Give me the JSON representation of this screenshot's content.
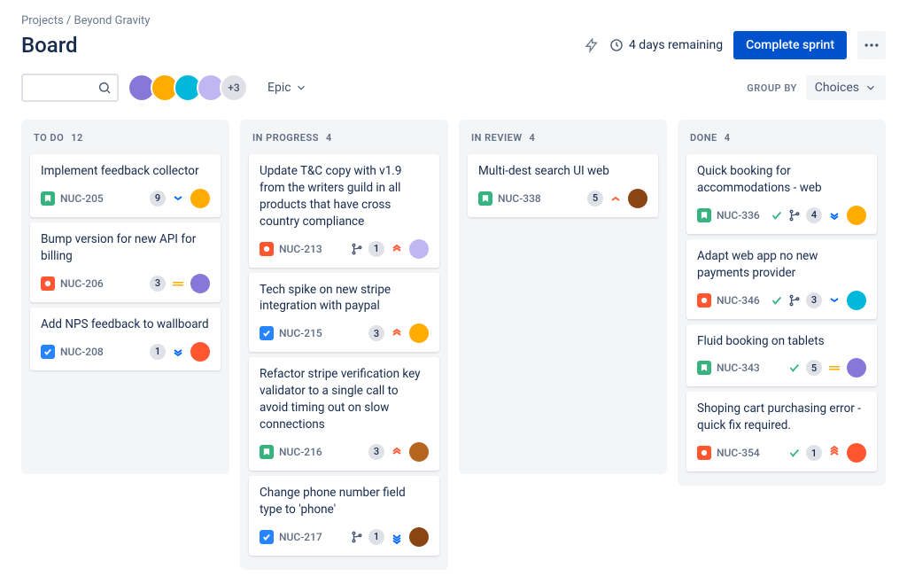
{
  "breadcrumb": {
    "root": "Projects",
    "project": "Beyond Gravity"
  },
  "page_title": "Board",
  "header": {
    "days_remaining": "4 days remaining",
    "complete_sprint": "Complete sprint"
  },
  "toolbar": {
    "search_placeholder": "",
    "avatars_more": "+3",
    "epic_label": "Epic",
    "group_by_label": "GROUP BY",
    "group_by_value": "Choices"
  },
  "avatar_colors": [
    "#8777d9",
    "#ffab00",
    "#00b8d9",
    "#c0b6f2"
  ],
  "columns": [
    {
      "title": "TO DO",
      "count": "12"
    },
    {
      "title": "IN PROGRESS",
      "count": "4"
    },
    {
      "title": "IN REVIEW",
      "count": "4"
    },
    {
      "title": "DONE",
      "count": "4"
    }
  ],
  "cards": {
    "todo": [
      {
        "title": "Implement feedback collector",
        "type": "story",
        "key": "NUC-205",
        "points": "9",
        "priority": "low",
        "avatar": "#ffab00"
      },
      {
        "title": "Bump version for new API for billing",
        "type": "bug",
        "key": "NUC-206",
        "points": "3",
        "priority": "medium",
        "avatar": "#8777d9"
      },
      {
        "title": "Add NPS feedback to wallboard",
        "type": "task",
        "key": "NUC-208",
        "points": "1",
        "priority": "low-double",
        "avatar": "#ff5630"
      }
    ],
    "inprogress": [
      {
        "title": "Update T&C copy with v1.9 from the writers guild in all products that have cross country compliance",
        "type": "bug",
        "key": "NUC-213",
        "branch": true,
        "points": "1",
        "priority": "high-double",
        "avatar": "#c0b6f2"
      },
      {
        "title": "Tech spike on new stripe integration with paypal",
        "type": "task",
        "key": "NUC-215",
        "points": "3",
        "priority": "high-double",
        "avatar": "#ffab00"
      },
      {
        "title": "Refactor stripe verification key validator to a single call to avoid timing out on slow connections",
        "type": "story",
        "key": "NUC-216",
        "points": "3",
        "priority": "high-double",
        "avatar": "#b5651d"
      },
      {
        "title": "Change phone number field type to 'phone'",
        "type": "task",
        "key": "NUC-217",
        "branch": true,
        "points": "1",
        "priority": "low-triple",
        "avatar": "#8b4513"
      }
    ],
    "inreview": [
      {
        "title": "Multi-dest search UI web",
        "type": "story",
        "key": "NUC-338",
        "points": "5",
        "priority": "high",
        "avatar": "#8b4513"
      }
    ],
    "done": [
      {
        "title": "Quick booking for accommodations - web",
        "type": "story",
        "key": "NUC-336",
        "done": true,
        "branch": true,
        "points": "4",
        "priority": "low-double",
        "avatar": "#ffab00"
      },
      {
        "title": "Adapt web app no new payments provider",
        "type": "bug",
        "key": "NUC-346",
        "done": true,
        "branch": true,
        "points": "3",
        "priority": "low",
        "avatar": "#00b8d9"
      },
      {
        "title": "Fluid booking on tablets",
        "type": "story",
        "key": "NUC-343",
        "done": true,
        "points": "5",
        "priority": "medium",
        "avatar": "#8777d9"
      },
      {
        "title": "Shoping cart purchasing error - quick fix required.",
        "type": "bug",
        "key": "NUC-354",
        "done": true,
        "points": "1",
        "priority": "high-triple",
        "avatar": "#ff5630"
      }
    ]
  }
}
